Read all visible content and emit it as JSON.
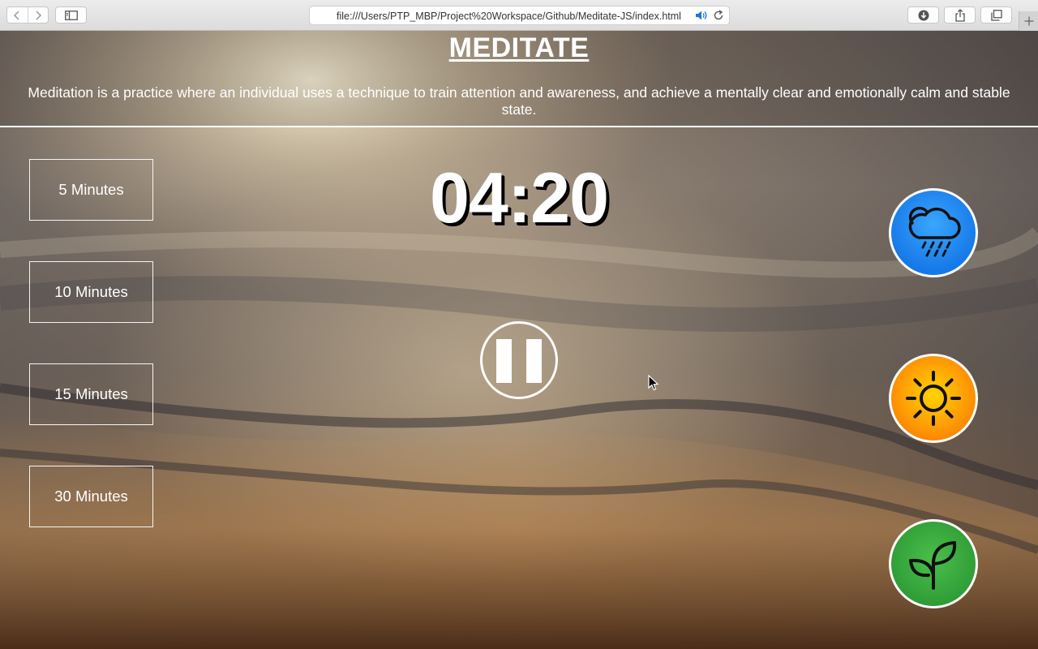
{
  "browser": {
    "url": "file:///Users/PTP_MBP/Project%20Workspace/Github/Meditate-JS/index.html"
  },
  "page": {
    "title": "MEDITATE",
    "description": "Meditation is a practice where an individual uses a technique to train attention and awareness, and achieve a mentally clear and emotionally calm and stable state."
  },
  "durations": [
    {
      "label": "5 Minutes"
    },
    {
      "label": "10 Minutes"
    },
    {
      "label": "15 Minutes"
    },
    {
      "label": "30 Minutes"
    }
  ],
  "timer": {
    "display": "04:20",
    "state": "playing"
  },
  "sounds": [
    {
      "name": "rain",
      "icon": "rain-cloud-icon",
      "color": "#1679e8"
    },
    {
      "name": "sun",
      "icon": "sun-icon",
      "color": "#ff9a05"
    },
    {
      "name": "plant",
      "icon": "sprout-icon",
      "color": "#2e9b35"
    }
  ],
  "colors": {
    "text": "#ffffff",
    "timer_shadow": "#000000"
  }
}
